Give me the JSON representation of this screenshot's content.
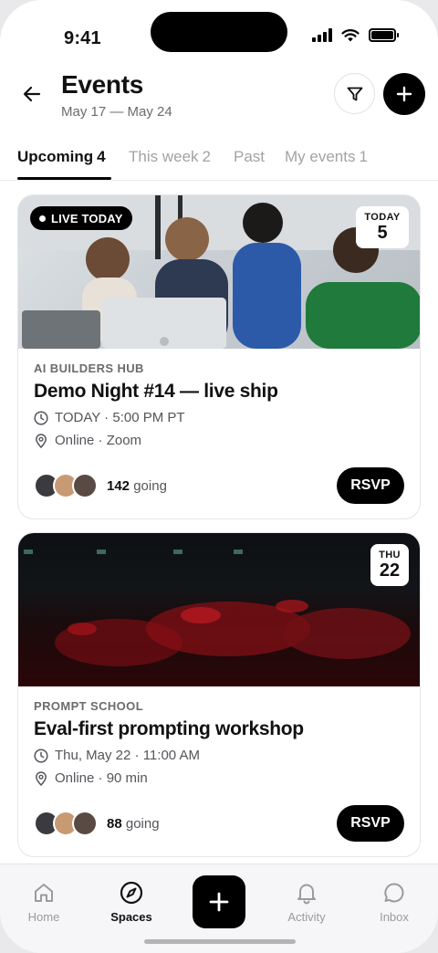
{
  "status_bar": {
    "time": "9:41"
  },
  "header": {
    "title": "Events",
    "subtitle": "May 17 — May 24",
    "icons": {
      "back": "arrow-left-icon",
      "filter": "filter-icon",
      "add": "plus-icon"
    }
  },
  "tabs": [
    {
      "label": "Upcoming",
      "count": "4",
      "active": true
    },
    {
      "label": "This week",
      "count": "2",
      "active": false
    },
    {
      "label": "Past",
      "count": "",
      "active": false
    },
    {
      "label": "My events",
      "count": "1",
      "active": false
    }
  ],
  "events": [
    {
      "live_label": "LIVE TODAY",
      "date_day": "TODAY",
      "date_num": "5",
      "organizer": "AI BUILDERS HUB",
      "title": "Demo Night #14 — live ship",
      "time": "TODAY · 5:00 PM PT",
      "location": "Online · Zoom",
      "going_count": "142",
      "going_label": "going",
      "rsvp_label": "RSVP"
    },
    {
      "date_day": "THU",
      "date_num": "22",
      "organizer": "PROMPT SCHOOL",
      "title": "Eval-first prompting workshop",
      "time": "Thu, May 22 · 11:00 AM",
      "location": "Online · 90 min",
      "going_count": "88",
      "going_label": "going",
      "rsvp_label": "RSVP"
    }
  ],
  "bottom_nav": [
    {
      "label": "Home",
      "icon": "home-icon",
      "active": false
    },
    {
      "label": "Spaces",
      "icon": "compass-icon",
      "active": true
    },
    {
      "label": "",
      "icon": "plus-icon",
      "active": false
    },
    {
      "label": "Activity",
      "icon": "bell-icon",
      "active": false
    },
    {
      "label": "Inbox",
      "icon": "chat-bubble-icon",
      "active": false
    }
  ],
  "colors": {
    "accent": "#000000",
    "muted": "#9a9aa0",
    "background": "#ffffff"
  }
}
